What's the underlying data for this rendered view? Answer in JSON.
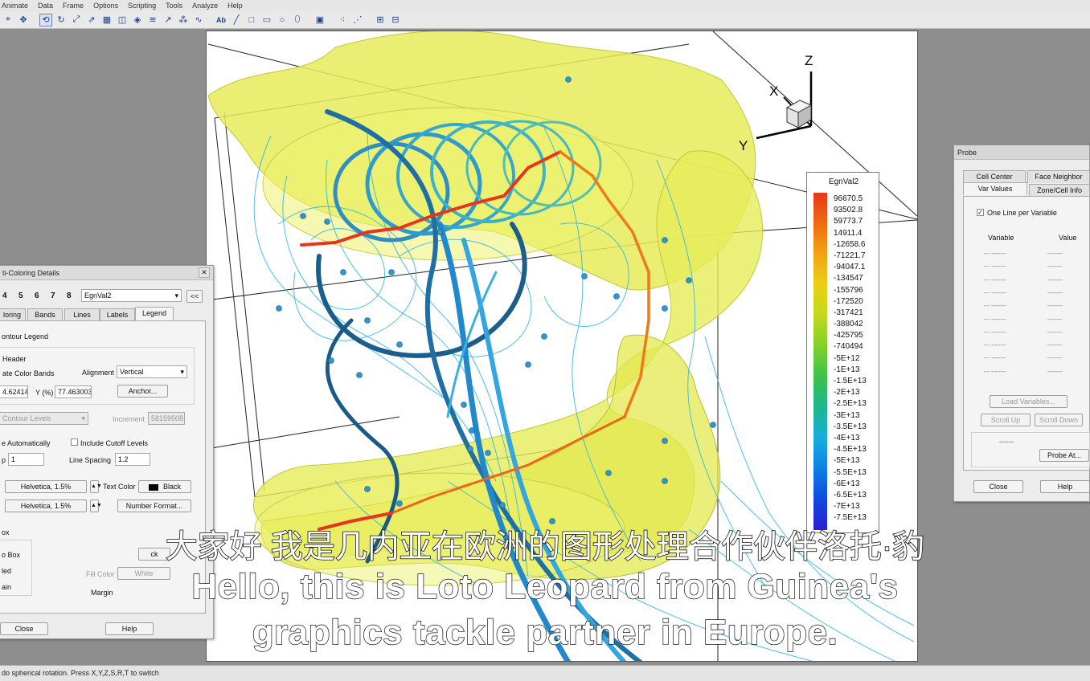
{
  "menu": [
    "Animate",
    "Data",
    "Frame",
    "Options",
    "Scripting",
    "Tools",
    "Analyze",
    "Help"
  ],
  "toolbar_icons": [
    "probe-icon",
    "translate-icon",
    "rotate-icon",
    "spherical-rotate-icon",
    "zoom-icon",
    "stream-icon",
    "mesh-icon",
    "slice-icon",
    "isosurface-icon",
    "contour-icon",
    "vector-icon",
    "scatter-icon",
    "streamtrace-icon",
    "text-icon",
    "geometry-line-icon",
    "rectangle-icon",
    "square-icon",
    "circle-icon",
    "ellipse-icon",
    "frame-icon",
    "point-icon",
    "poly-icon",
    "grid-icon",
    "snap-icon"
  ],
  "plot": {
    "axes": {
      "z": "Z",
      "x": "X",
      "y": "Y"
    },
    "legend": {
      "title": "EgnVal2",
      "labels": [
        "96670.5",
        "93502.8",
        "59773.7",
        "14911.4",
        "-12658.6",
        "-71221.7",
        "-94047.1",
        "-134547",
        "-155796",
        "-172520",
        "-317421",
        "-388042",
        "-425795",
        "-740494",
        "-5E+12",
        "-1E+13",
        "-1.5E+13",
        "-2E+13",
        "-2.5E+13",
        "-3E+13",
        "-3.5E+13",
        "-4E+13",
        "-4.5E+13",
        "-5E+13",
        "-5.5E+13",
        "-6E+13",
        "-6.5E+13",
        "-7E+13",
        "-7.5E+13"
      ],
      "colors": [
        "#e8361a",
        "#ef6a12",
        "#f4a314",
        "#e9cf17",
        "#c3d91b",
        "#7fd02a",
        "#3dc24a",
        "#1eb68c",
        "#17aede",
        "#0f7fe6",
        "#1148e0",
        "#2a1fd0"
      ]
    }
  },
  "contour_panel": {
    "title": "ti-Coloring Details",
    "close": "✕",
    "numbers": [
      "4",
      "5",
      "6",
      "7",
      "8"
    ],
    "variable": "EgnVal2",
    "collapse": "<<",
    "tabs": [
      "loring",
      "Bands",
      "Lines",
      "Labels",
      "Legend"
    ],
    "active_tab": "Legend",
    "contour_legend": "ontour Legend",
    "header": "Header",
    "separate_bands": "ate Color Bands",
    "alignment_label": "Alignment",
    "alignment_value": "Vertical",
    "x_value": "4.624148",
    "y_label": "Y (%)",
    "y_value": "77.463003",
    "anchor_button": "Anchor...",
    "levels_value": "Contour Levels",
    "increment_label": "Increment",
    "increment_value": "58159508",
    "automatic": "e Automatically",
    "include_cutoff": "Include Cutoff Levels",
    "skip_label": "p",
    "skip_value": "1",
    "line_spacing_label": "Line Spacing",
    "line_spacing_value": "1.2",
    "font1": "Helvetica, 1.5%",
    "text_color_label": "Text Color",
    "text_color_value": "Black",
    "font2": "Helvetica, 1.5%",
    "number_format_button": "Number Format...",
    "box_label": "ox",
    "box_opt1": "o Box",
    "box_opt2": "led",
    "box_opt3": "ain",
    "fill_color_label": "Fill Color",
    "fill_color_value": "White",
    "margin_label": "Margin",
    "color_button": "ck",
    "close_button": "Close",
    "help_button": "Help"
  },
  "probe_panel": {
    "title": "Probe",
    "tabs_top": [
      "Cell Center",
      "Face Neighbor"
    ],
    "tabs_bottom": [
      "Var Values",
      "Zone/Cell Info"
    ],
    "one_line": "One Line per Variable",
    "col_variable": "Variable",
    "col_value": "Value",
    "rows": [
      [
        "--- --------",
        "--------"
      ],
      [
        "--- --------",
        "--------"
      ],
      [
        "--- --------",
        "--------"
      ],
      [
        "--- --------",
        "--------"
      ],
      [
        "--- --------",
        "--------"
      ],
      [
        "--- --------",
        "--------"
      ],
      [
        "--- --------",
        "--------"
      ],
      [
        "--- --------",
        "--------"
      ],
      [
        "--- --------",
        "--------"
      ],
      [
        "--- --------",
        "--------"
      ]
    ],
    "load_variables": "Load Variables...",
    "scroll_up": "Scroll Up",
    "scroll_down": "Scroll Down",
    "dash": "------",
    "probe_at": "Probe At...",
    "close": "Close",
    "help": "Help"
  },
  "status": "do spherical rotation. Press X,Y,Z,S,R,T to switch",
  "subtitles": {
    "chinese": "大家好 我是几内亚在欧洲的图形处理合作伙伴洛托·豹",
    "english_1": "Hello, this is Loto Leopard from Guinea's",
    "english_2": "graphics tackle partner in Europe."
  }
}
